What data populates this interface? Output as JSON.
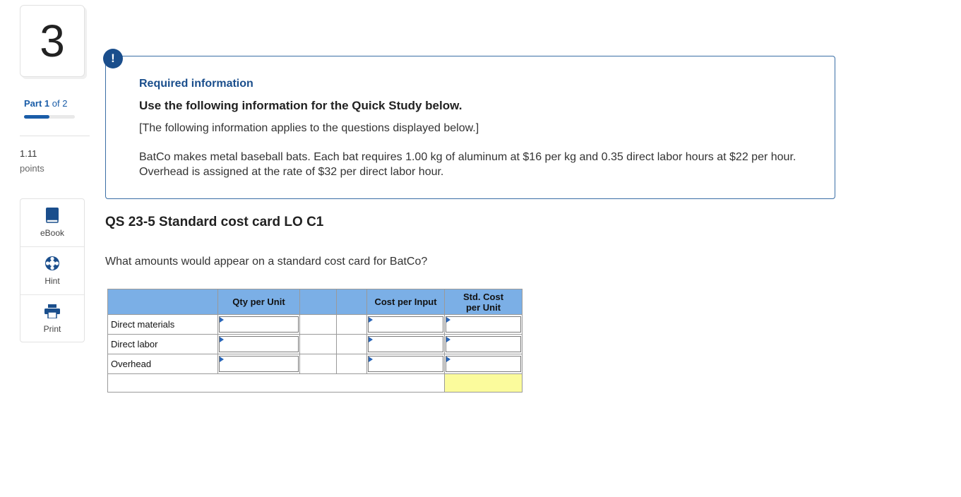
{
  "question_number": "3",
  "part": {
    "prefix": "Part",
    "current": "1",
    "of_text": "of 2",
    "progress": 0.5
  },
  "points": {
    "value": "1.11",
    "label": "points"
  },
  "tools": [
    {
      "icon": "book-icon",
      "label": "eBook"
    },
    {
      "icon": "lifebuoy-icon",
      "label": "Hint"
    },
    {
      "icon": "printer-icon",
      "label": "Print"
    }
  ],
  "required": {
    "badge": "!",
    "title": "Required information",
    "heading": "Use the following information for the Quick Study below.",
    "applies": "[The following information applies to the questions displayed below.]",
    "problem": "BatCo makes metal baseball bats. Each bat requires 1.00 kg of aluminum at $16 per kg and 0.35 direct labor hours at $22 per hour. Overhead is assigned at the rate of $32 per direct labor hour."
  },
  "qs_title": "QS 23-5 Standard cost card LO C1",
  "question_text": "What amounts would appear on a standard cost card for BatCo?",
  "table": {
    "headers": [
      "",
      "Qty per Unit",
      "",
      "",
      "Cost per Input",
      "Std. Cost per Unit"
    ],
    "rows": [
      {
        "label": "Direct materials",
        "qty": "",
        "cost": "",
        "std": ""
      },
      {
        "label": "Direct labor",
        "qty": "",
        "cost": "",
        "std": ""
      },
      {
        "label": "Overhead",
        "qty": "",
        "cost": "",
        "std": ""
      }
    ],
    "total": ""
  },
  "colors": {
    "accent": "#1a4e8c",
    "header_bg": "#7bafe6",
    "total_bg": "#fbfb9c"
  }
}
